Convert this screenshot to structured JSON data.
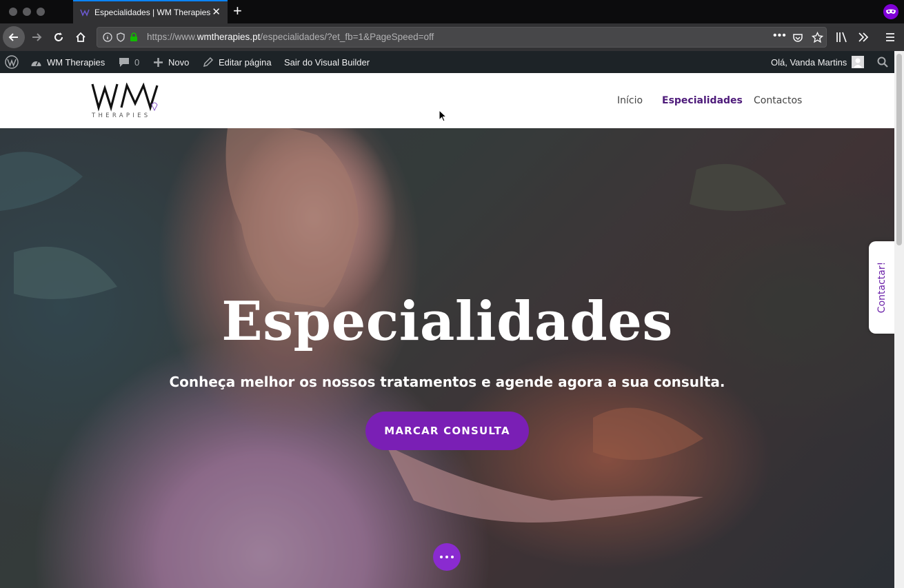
{
  "browser": {
    "tab_title": "Especialidades | WM Therapies",
    "url_prefix": "https://www.",
    "url_domain": "wmtherapies.pt",
    "url_path": "/especialidades/?et_fb=1&PageSpeed=off"
  },
  "adminbar": {
    "site_name": "WM Therapies",
    "comments_count": "0",
    "new_label": "Novo",
    "edit_label": "Editar página",
    "exit_label": "Sair do Visual Builder",
    "greeting": "Olá, Vanda Martins"
  },
  "header": {
    "menu": [
      "Início",
      "Especialidades",
      "Contactos"
    ],
    "active_menu": "Especialidades"
  },
  "hero": {
    "title": "Especialidades",
    "subtitle": "Conheça melhor os nossos tratamentos e agende agora a sua consulta.",
    "cta_label": "MARCAR CONSULTA",
    "side_tab_label": "Contactar!"
  },
  "colors": {
    "accent": "#7a1fb5",
    "menu_active": "#4d1a7a",
    "admin_bar": "#1d2327"
  }
}
